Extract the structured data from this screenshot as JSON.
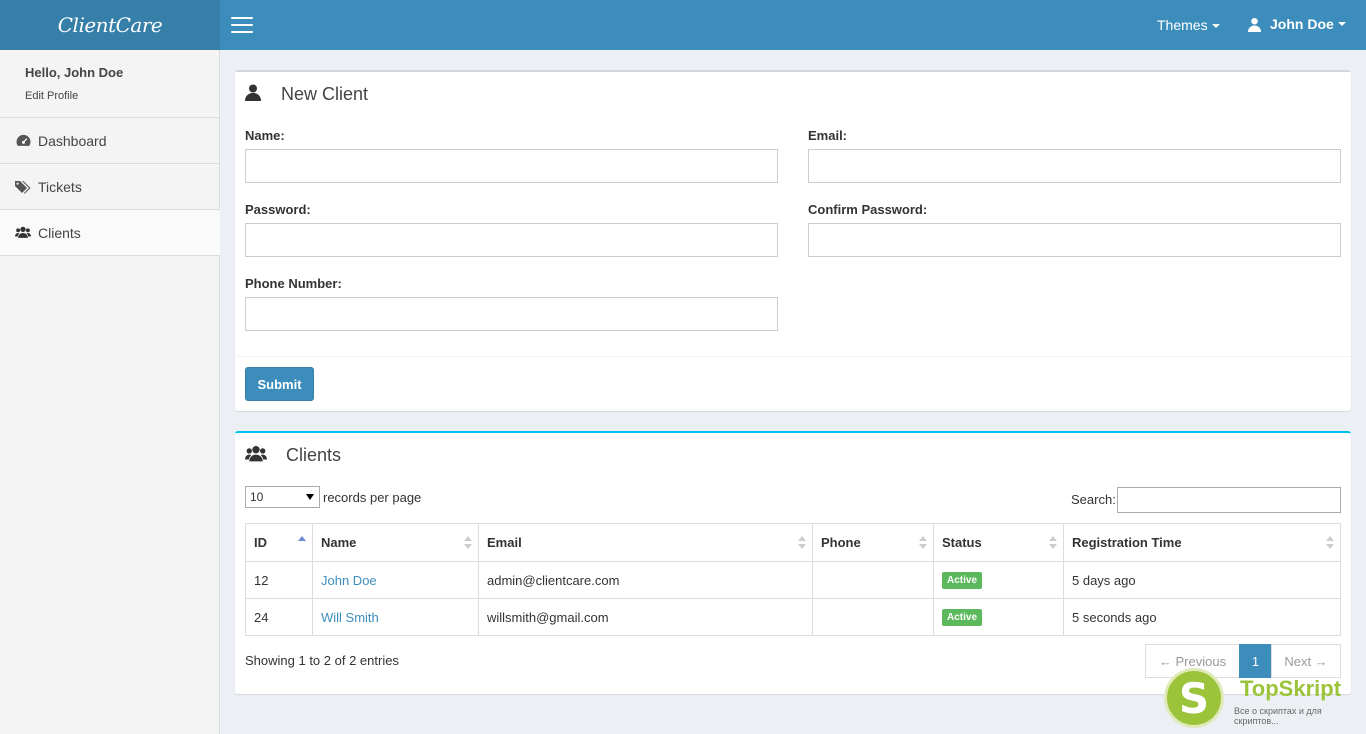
{
  "header": {
    "logo": "ClientCare",
    "themes_label": "Themes",
    "user_name": "John Doe"
  },
  "sidebar": {
    "greeting": "Hello, John Doe",
    "edit_profile": "Edit Profile",
    "items": [
      {
        "label": "Dashboard",
        "icon": "dashboard-icon"
      },
      {
        "label": "Tickets",
        "icon": "tags-icon"
      },
      {
        "label": "Clients",
        "icon": "users-icon"
      }
    ]
  },
  "new_client": {
    "title": "New Client",
    "name_label": "Name:",
    "email_label": "Email:",
    "password_label": "Password:",
    "confirm_password_label": "Confirm Password:",
    "phone_label": "Phone Number:",
    "name_value": "",
    "email_value": "",
    "password_value": "",
    "confirm_password_value": "",
    "phone_value": "",
    "submit_label": "Submit"
  },
  "clients": {
    "title": "Clients",
    "per_page_value": "10",
    "per_page_label": "records per page",
    "search_label": "Search:",
    "search_value": "",
    "columns": [
      "ID",
      "Name",
      "Email",
      "Phone",
      "Status",
      "Registration Time"
    ],
    "rows": [
      {
        "id": "12",
        "name": "John Doe",
        "email": "admin@clientcare.com",
        "phone": "",
        "status": "Active",
        "registered": "5 days ago"
      },
      {
        "id": "24",
        "name": "Will Smith",
        "email": "willsmith@gmail.com",
        "phone": "",
        "status": "Active",
        "registered": "5 seconds ago"
      }
    ],
    "showing": "Showing 1 to 2 of 2 entries",
    "pager": {
      "previous": "← Previous",
      "current": "1",
      "next": "Next →"
    }
  },
  "watermark": {
    "letter": "S",
    "brand": "TopSkript",
    "tagline": "Все о скриптах и для скриптов..."
  },
  "colors": {
    "header": "#3c8dbc",
    "logo_bg": "#367fa9",
    "status_active": "#5cb85c",
    "box_accent": "#00c0ef"
  }
}
